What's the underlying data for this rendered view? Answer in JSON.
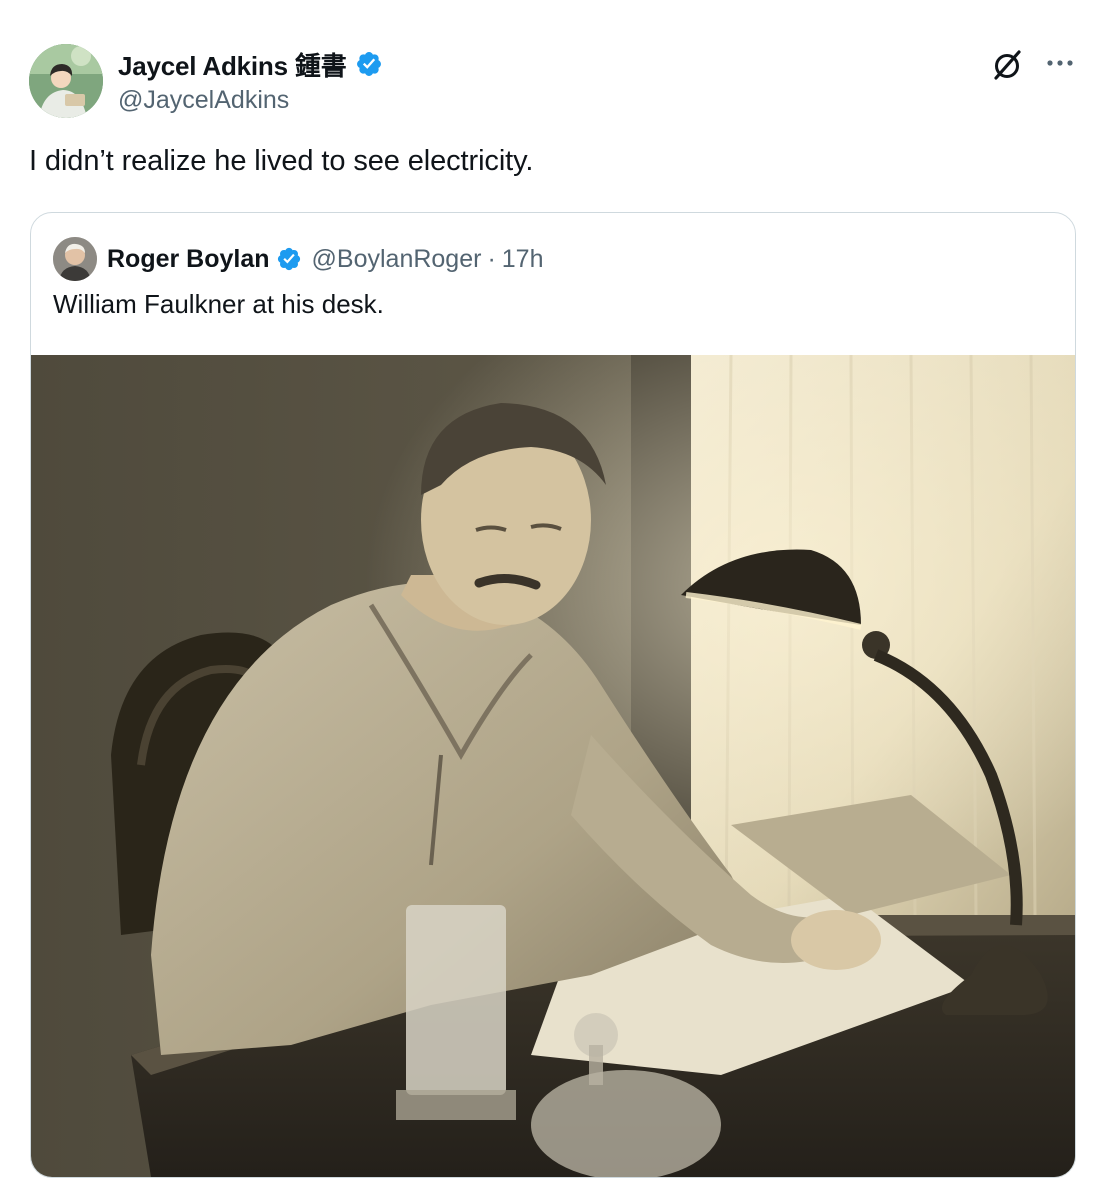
{
  "tweet": {
    "author": {
      "display_name": "Jaycel Adkins 鍾書",
      "handle": "@JaycelAdkins",
      "verified": true,
      "avatar_icon": "anime-avatar-icon"
    },
    "text": "I didn’t realize he lived to see electricity.",
    "actions": {
      "grok_icon": "grok-icon",
      "more_icon": "more-options-icon"
    }
  },
  "quote": {
    "author": {
      "display_name": "Roger Boylan",
      "handle": "@BoylanRoger",
      "verified": true,
      "avatar_icon": "profile-photo-icon"
    },
    "separator": "·",
    "time": "17h",
    "text": "William Faulkner at his desk.",
    "photo_icon": "sepia-photo-man-writing-at-desk-with-lamp"
  },
  "colors": {
    "text_primary": "#0f1419",
    "text_secondary": "#536471",
    "verified_blue": "#1d9bf0",
    "border": "#cfd9de"
  }
}
